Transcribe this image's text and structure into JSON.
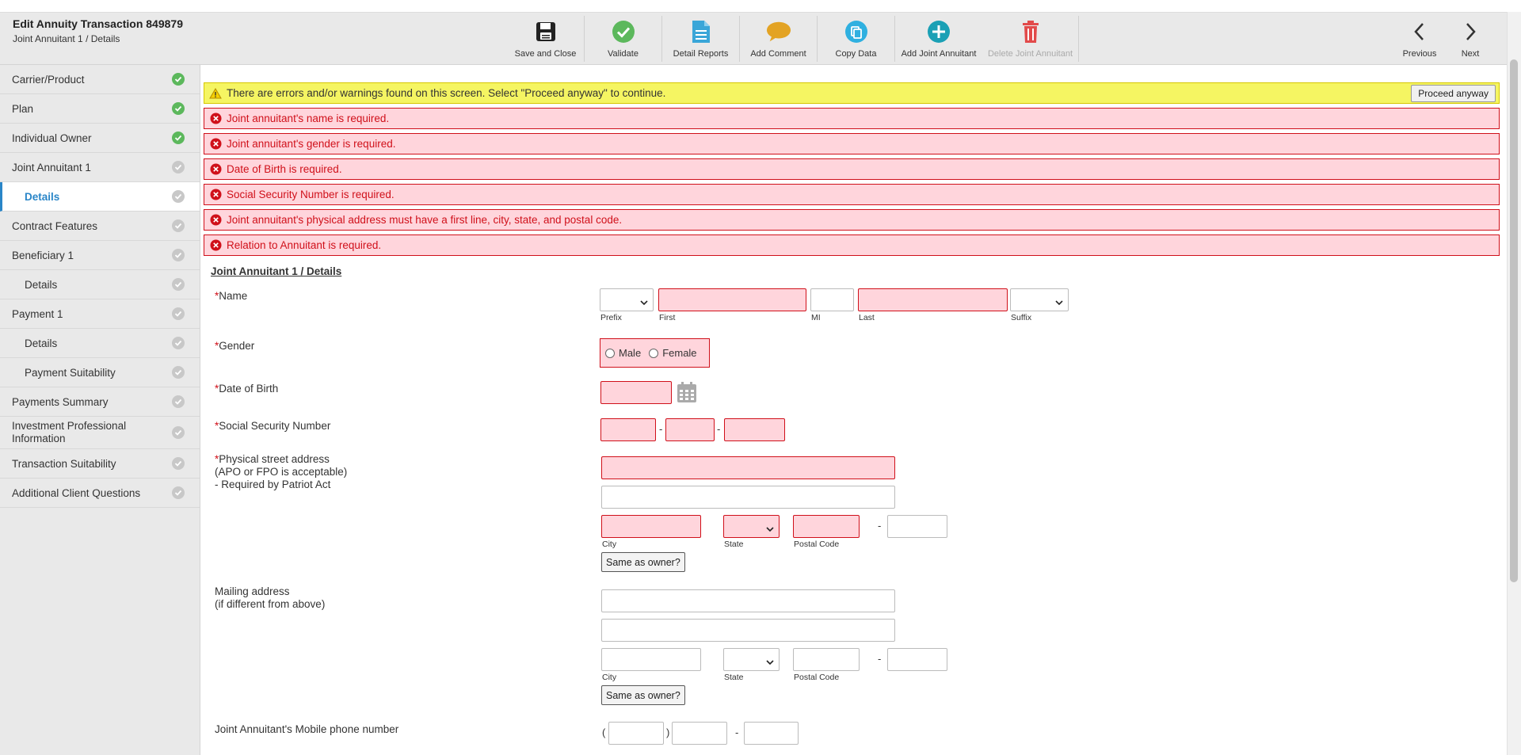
{
  "header": {
    "title": "Edit Annuity Transaction 849879",
    "subtitle": "Joint Annuitant 1 / Details"
  },
  "toolbar": {
    "save_close": "Save and Close",
    "validate": "Validate",
    "detail_reports": "Detail Reports",
    "add_comment": "Add Comment",
    "copy_data": "Copy Data",
    "add_joint": "Add Joint Annuitant",
    "delete_joint": "Delete Joint Annuitant",
    "previous": "Previous",
    "next": "Next"
  },
  "sidebar": {
    "items": [
      {
        "label": "Carrier/Product",
        "status": "done"
      },
      {
        "label": "Plan",
        "status": "done"
      },
      {
        "label": "Individual Owner",
        "status": "done"
      },
      {
        "label": "Joint Annuitant 1",
        "status": "todo"
      },
      {
        "label": "Details",
        "status": "todo"
      },
      {
        "label": "Contract Features",
        "status": "todo"
      },
      {
        "label": "Beneficiary 1",
        "status": "todo"
      },
      {
        "label": "Details",
        "status": "todo"
      },
      {
        "label": "Payment 1",
        "status": "todo"
      },
      {
        "label": "Details",
        "status": "todo"
      },
      {
        "label": "Payment Suitability",
        "status": "todo"
      },
      {
        "label": "Payments Summary",
        "status": "todo"
      },
      {
        "label": "Investment Professional Information",
        "status": "todo"
      },
      {
        "label": "Transaction Suitability",
        "status": "todo"
      },
      {
        "label": "Additional Client Questions",
        "status": "todo"
      }
    ]
  },
  "warning": {
    "text": "There are errors and/or warnings found on this screen. Select \"Proceed anyway\" to continue.",
    "button": "Proceed anyway"
  },
  "errors": [
    "Joint annuitant's name is required.",
    "Joint annuitant's gender is required.",
    "Date of Birth is required.",
    "Social Security Number is required.",
    "Joint annuitant's physical address must have a first line, city, state, and postal code.",
    "Relation to Annuitant is required."
  ],
  "form": {
    "section_title": "Joint Annuitant 1 / Details",
    "required_mark": "*",
    "name_label": "Name",
    "prefix": "Prefix",
    "first": "First",
    "mi": "MI",
    "last": "Last",
    "suffix": "Suffix",
    "gender_label": "Gender",
    "male": "Male",
    "female": "Female",
    "dob_label": "Date of Birth",
    "ssn_label": "Social Security Number",
    "physical_label_1": "Physical street address",
    "physical_label_2": "(APO or FPO is acceptable)",
    "physical_label_3": "- Required by Patriot Act",
    "city": "City",
    "state": "State",
    "postal": "Postal Code",
    "same_as_owner": "Same as owner?",
    "mailing_label_1": "Mailing address",
    "mailing_label_2": "(if different from above)",
    "mobile_label": "Joint Annuitant's Mobile phone number",
    "dash": "-",
    "paren_open": "(",
    "paren_close": ")"
  }
}
